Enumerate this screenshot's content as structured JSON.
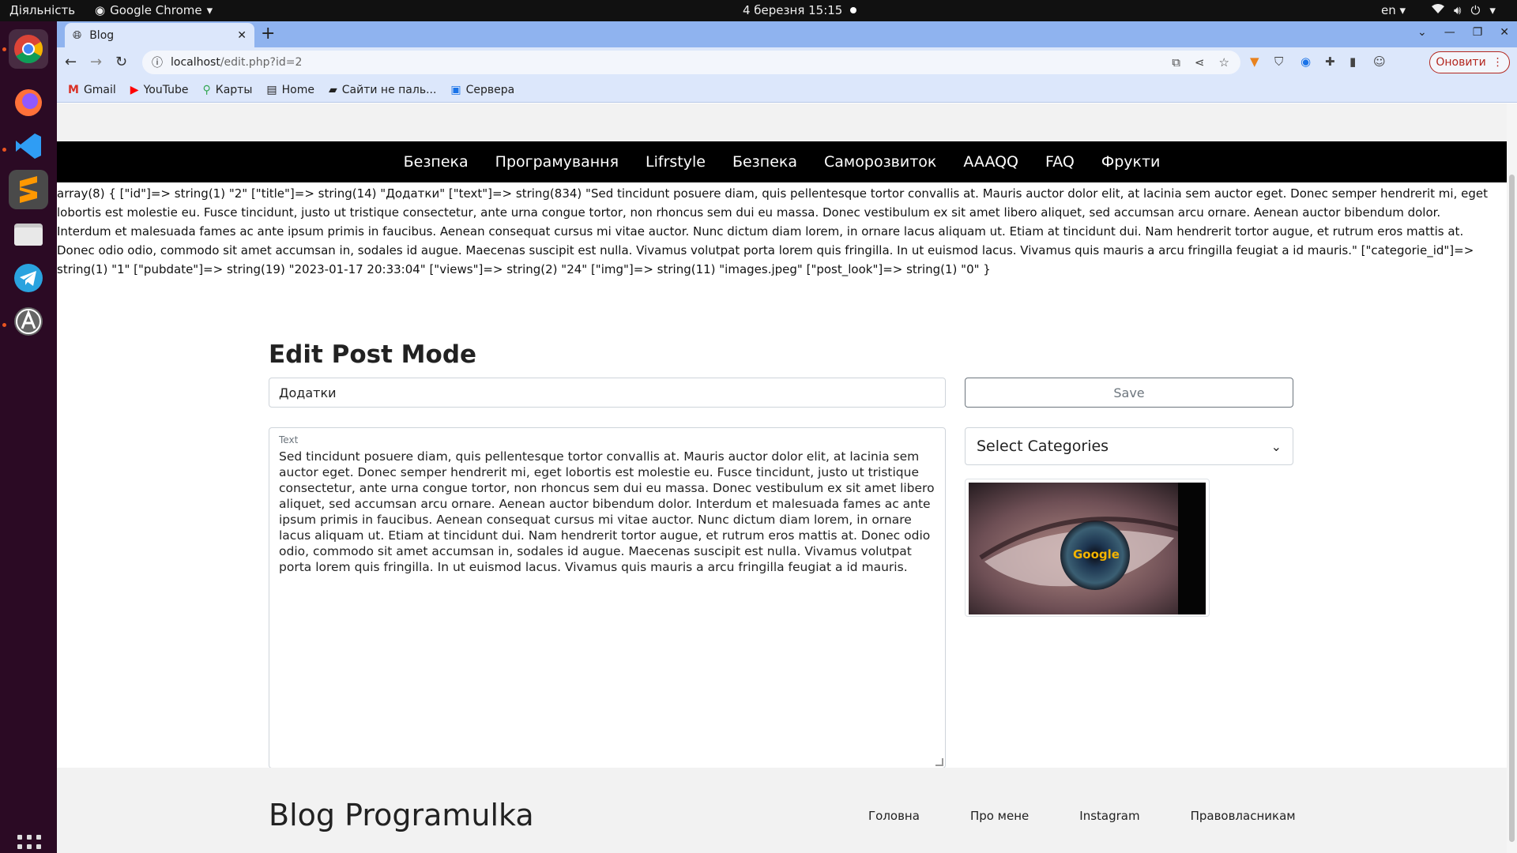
{
  "system": {
    "activities": "Діяльність",
    "app_name": "Google Chrome",
    "clock": "4 березня  15:15",
    "lang": "en"
  },
  "browser": {
    "tab_title": "Blog",
    "url_base": "localhost",
    "url_rest": "/edit.php?id=2",
    "update_label": "Оновити",
    "bookmarks": [
      "Gmail",
      "YouTube",
      "Карты",
      "Home",
      "Сайти не паль...",
      "Сервера"
    ]
  },
  "nav": {
    "items": [
      "Безпека",
      "Програмування",
      "Lifrstyle",
      "Безпека",
      "Саморозвиток",
      "AAAQQ",
      "FAQ",
      "Фрукти"
    ]
  },
  "debug_dump": "array(8) { [\"id\"]=> string(1) \"2\" [\"title\"]=> string(14) \"Додатки\" [\"text\"]=> string(834) \"Sed tincidunt posuere diam, quis pellentesque tortor convallis at. Mauris auctor dolor elit, at lacinia sem auctor eget. Donec semper hendrerit mi, eget lobortis est molestie eu. Fusce tincidunt, justo ut tristique consectetur, ante urna congue tortor, non rhoncus sem dui eu massa. Donec vestibulum ex sit amet libero aliquet, sed accumsan arcu ornare. Aenean auctor bibendum dolor. Interdum et malesuada fames ac ante ipsum primis in faucibus. Aenean consequat cursus mi vitae auctor. Nunc dictum diam lorem, in ornare lacus aliquam ut. Etiam at tincidunt dui. Nam hendrerit tortor augue, et rutrum eros mattis at. Donec odio odio, commodo sit amet accumsan in, sodales id augue. Maecenas suscipit est nulla. Vivamus volutpat porta lorem quis fringilla. In ut euismod lacus. Vivamus quis mauris a arcu fringilla feugiat a id mauris.\" [\"categorie_id\"]=> string(1) \"1\" [\"pubdate\"]=> string(19) \"2023-01-17 20:33:04\" [\"views\"]=> string(2) \"24\" [\"img\"]=> string(11) \"images.jpeg\" [\"post_look\"]=> string(1) \"0\" }",
  "edit": {
    "heading": "Edit Post Mode",
    "title_value": "Додатки",
    "save_label": "Save",
    "text_label": "Text",
    "text_value": "Sed tincidunt posuere diam, quis pellentesque tortor convallis at. Mauris auctor dolor elit, at lacinia sem auctor eget. Donec semper hendrerit mi, eget lobortis est molestie eu. Fusce tincidunt, justo ut tristique consectetur, ante urna congue tortor, non rhoncus sem dui eu massa. Donec vestibulum ex sit amet libero aliquet, sed accumsan arcu ornare. Aenean auctor bibendum dolor. Interdum et malesuada fames ac ante ipsum primis in faucibus. Aenean consequat cursus mi vitae auctor. Nunc dictum diam lorem, in ornare lacus aliquam ut. Etiam at tincidunt dui. Nam hendrerit tortor augue, et rutrum eros mattis at. Donec odio odio, commodo sit amet accumsan in, sodales id augue. Maecenas suscipit est nulla. Vivamus volutpat porta lorem quis fringilla. In ut euismod lacus. Vivamus quis mauris a arcu fringilla feugiat a id mauris.",
    "category_selected": "Select Categories",
    "image_alt": "Google"
  },
  "footer": {
    "brand": "Blog Programulka",
    "links": [
      "Головна",
      "Про мене",
      "Instagram",
      "Правовласникам"
    ]
  },
  "colors": {
    "nav_bg": "#000000",
    "update_accent": "#b3261e",
    "chrome_tab_bg": "#8fb3ef"
  }
}
